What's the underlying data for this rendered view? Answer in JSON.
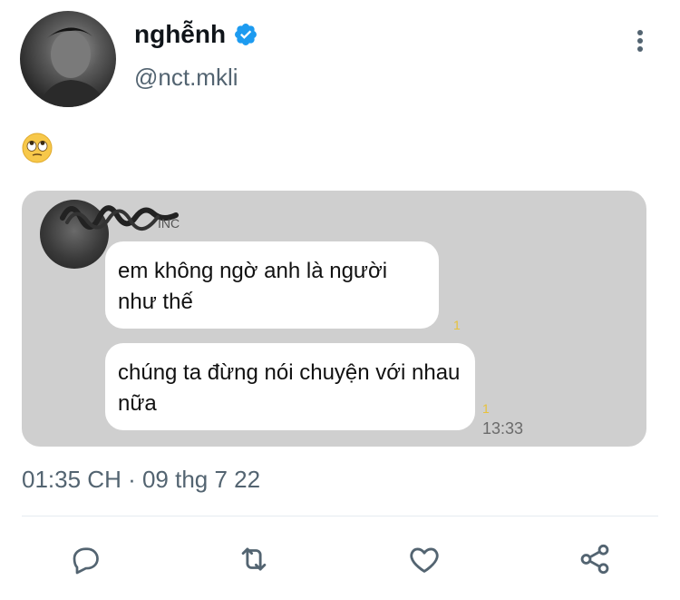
{
  "tweet": {
    "author_name": "nghễnh",
    "author_handle": "@nct.mkli",
    "text": "🙄",
    "timestamp": "01:35 CH · 09 thg 7 22"
  },
  "attached_image": {
    "messages": [
      {
        "text": "em không ngờ anh là người như thế",
        "read_count": "1"
      },
      {
        "text": "chúng ta đừng nói chuyện với nhau nữa",
        "read_count": "1"
      }
    ],
    "sent_time": "13:33",
    "sender_name_fragment": "INC"
  },
  "actions": {
    "reply": "reply-icon",
    "retweet": "retweet-icon",
    "like": "heart-icon",
    "share": "share-icon"
  },
  "colors": {
    "verified": "#1d9bf0",
    "secondary_text": "#536471",
    "read_mark": "#e8c23a",
    "chat_bg": "#cfcfcf"
  }
}
